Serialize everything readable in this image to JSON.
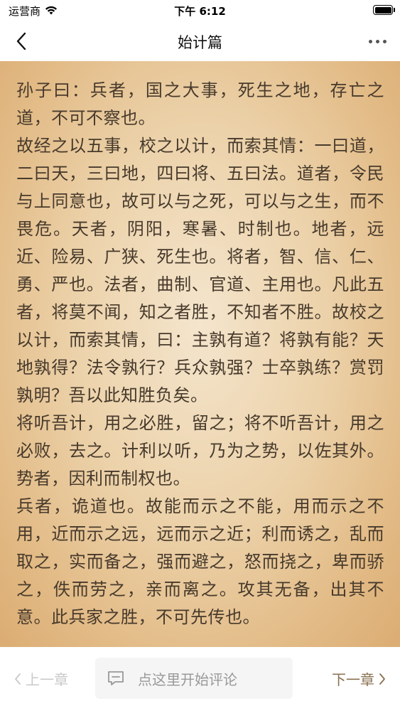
{
  "status_bar": {
    "carrier": "运营商",
    "time": "下午 6:12"
  },
  "nav": {
    "title": "始计篇"
  },
  "content": {
    "paragraphs": [
      "孙子曰：兵者，国之大事，死生之地，存亡之道，不可不察也。",
      "故经之以五事，校之以计，而索其情：一曰道，二曰天，三曰地，四曰将、五曰法。道者，令民与上同意也，故可以与之死，可以与之生，而不畏危。天者，阴阳，寒暑、时制也。地者，远近、险易、广狭、死生也。将者，智、信、仁、勇、严也。法者，曲制、官道、主用也。凡此五者，将莫不闻，知之者胜，不知者不胜。故校之以计，而索其情，曰：主孰有道？将孰有能？天地孰得？法令孰行？兵众孰强？士卒孰练？赏罚孰明？吾以此知胜负矣。",
      "将听吾计，用之必胜，留之；将不听吾计，用之必败，去之。计利以听，乃为之势，以佐其外。势者，因利而制权也。",
      "兵者，诡道也。故能而示之不能，用而示之不用，近而示之远，远而示之近；利而诱之，乱而取之，实而备之，强而避之，怒而挠之，卑而骄之，佚而劳之，亲而离之。攻其无备，出其不意。此兵家之胜，不可先传也。"
    ]
  },
  "bottom_bar": {
    "prev_label": "上一章",
    "comment_placeholder": "点这里开始评论",
    "next_label": "下一章"
  },
  "colors": {
    "reader_text": "#473a2c",
    "reader_bg_light": "#f4e5cd",
    "reader_bg_dark": "#dcae75",
    "next_label": "#8a7050",
    "prev_label_disabled": "#c9c9c9"
  },
  "icons": {
    "wifi": "wifi-icon",
    "battery": "battery-icon",
    "back": "chevron-left-icon",
    "more": "more-dots-icon",
    "comment": "comment-icon",
    "prev": "chevron-left-icon",
    "next": "chevron-right-icon"
  }
}
